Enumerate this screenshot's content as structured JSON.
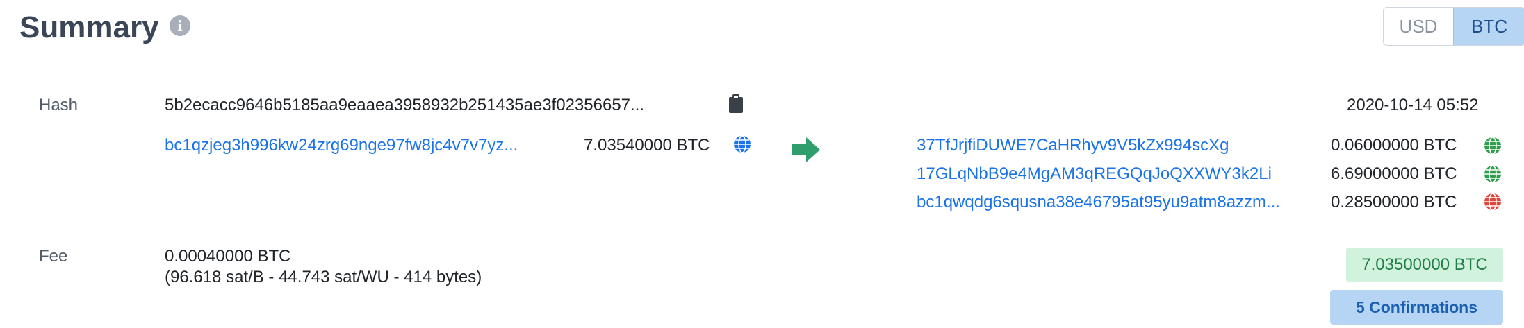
{
  "header": {
    "title": "Summary",
    "info_icon": "info-icon",
    "currency": {
      "options": [
        "USD",
        "BTC"
      ],
      "selected": "BTC"
    }
  },
  "hash": {
    "label": "Hash",
    "value": "5b2ecacc9646b5185aa9eaaea3958932b251435ae3f02356657...",
    "timestamp": "2020-10-14 05:52"
  },
  "inputs": [
    {
      "address": "bc1qzjeg3h996kw24zrg69nge97fw8jc4v7v7yz...",
      "amount": "7.03540000 BTC",
      "icon": "globe-blue"
    }
  ],
  "outputs": [
    {
      "address": "37TfJrjfiDUWE7CaHRhyv9V5kZx994scXg",
      "amount": "0.06000000 BTC",
      "icon": "globe-green"
    },
    {
      "address": "17GLqNbB9e4MgAM3qREGQqJoQXXWY3k2Li",
      "amount": "6.69000000 BTC",
      "icon": "globe-green"
    },
    {
      "address": "bc1qwqdg6squsna38e46795at95yu9atm8azzm...",
      "amount": "0.28500000 BTC",
      "icon": "globe-red"
    }
  ],
  "fee": {
    "label": "Fee",
    "value": "0.00040000 BTC",
    "detail": "(96.618 sat/B - 44.743 sat/WU - 414 bytes)"
  },
  "total": "7.03500000 BTC",
  "confirmations": "5 Confirmations",
  "colors": {
    "link": "#1a73e8",
    "arrow": "#2e9e6c",
    "globe_blue": "#1a73e8",
    "globe_green": "#2e9e4c",
    "globe_red": "#e0473c",
    "btc_selected_bg": "#b6d5f5",
    "total_bg": "#d1f2dd"
  }
}
